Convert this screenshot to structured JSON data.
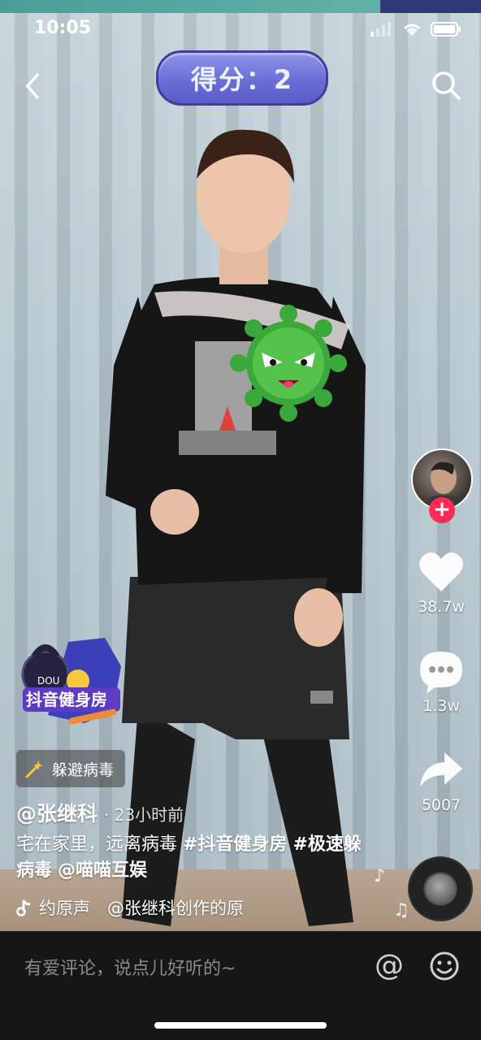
{
  "status_bar": {
    "time": "10:05"
  },
  "progress": {
    "fraction": 0.79
  },
  "game": {
    "score_label": "得分：2"
  },
  "badge": {
    "top_text": "DOU",
    "label": "抖音健身房"
  },
  "effect": {
    "label": "躲避病毒"
  },
  "post": {
    "author": "@张继科",
    "time_ago": "· 23小时前",
    "caption_plain_1": "宅在家里，远离病毒 ",
    "hashtag_1": "#抖音健身房",
    "hashtag_2": "#极速躲病毒",
    "mention": "@喵喵互娱",
    "music": "约原声　@张继科创作的原"
  },
  "actions": {
    "likes": "38.7w",
    "comments": "1.3w",
    "shares": "5007"
  },
  "comment_bar": {
    "placeholder": "有爱评论，说点儿好听的~"
  },
  "colors": {
    "accent": "#fe2c55",
    "score_bg": "#6a6fd6",
    "progress": "#5fb2a6"
  }
}
